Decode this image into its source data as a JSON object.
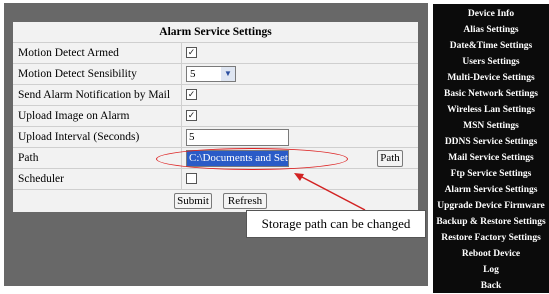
{
  "form": {
    "title": "Alarm Service Settings",
    "rows": [
      {
        "label": "Motion Detect Armed",
        "checked": true
      },
      {
        "label": "Motion Detect Sensibility",
        "value": "5"
      },
      {
        "label": "Send Alarm Notification by Mail",
        "checked": true
      },
      {
        "label": "Upload Image on Alarm",
        "checked": true
      },
      {
        "label": "Upload Interval (Seconds)",
        "value": "5"
      },
      {
        "label": "Path",
        "value": "C:\\Documents and Settings",
        "button": "Path"
      },
      {
        "label": "Scheduler",
        "checked": false
      }
    ],
    "submit_label": "Submit",
    "refresh_label": "Refresh"
  },
  "annotation": {
    "text": "Storage path can be changed",
    "color": "#d22222"
  },
  "sidebar": {
    "items": [
      {
        "label": "Device Info"
      },
      {
        "label": "Alias Settings"
      },
      {
        "label": "Date&Time Settings"
      },
      {
        "label": "Users Settings"
      },
      {
        "label": "Multi-Device Settings"
      },
      {
        "label": "Basic Network Settings"
      },
      {
        "label": "Wireless Lan Settings"
      },
      {
        "label": "MSN Settings"
      },
      {
        "label": "DDNS Service Settings"
      },
      {
        "label": "Mail Service Settings"
      },
      {
        "label": "Ftp Service Settings"
      },
      {
        "label": "Alarm Service Settings"
      },
      {
        "label": "Upgrade Device Firmware"
      },
      {
        "label": "Backup & Restore Settings"
      },
      {
        "label": "Restore Factory Settings"
      },
      {
        "label": "Reboot Device"
      },
      {
        "label": "Log"
      },
      {
        "label": "Back"
      }
    ]
  },
  "check_mark": "✓",
  "dropdown_icon": "chevron-down-icon"
}
